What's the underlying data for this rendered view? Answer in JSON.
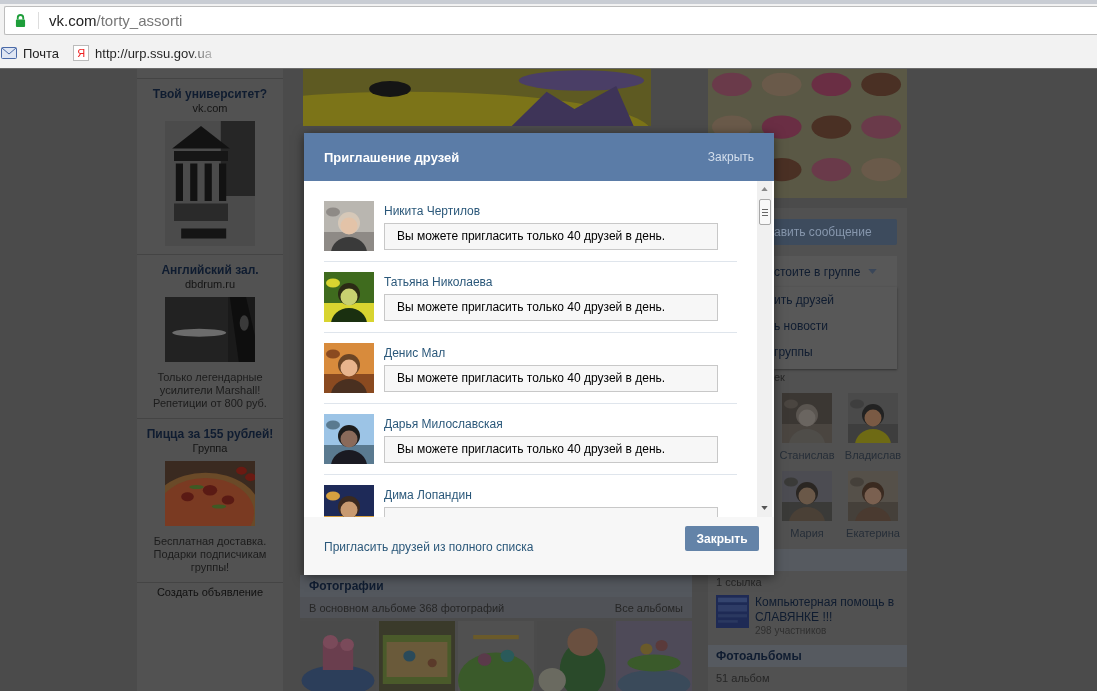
{
  "browser": {
    "address": {
      "host": "vk.com",
      "path": "/torty_assorti"
    },
    "bookmarks": [
      {
        "kind": "mail",
        "label": "Почта"
      },
      {
        "kind": "yandex",
        "icon_text": "Я",
        "label": "http://urp.ssu.gov.ua"
      }
    ]
  },
  "left_ads": [
    {
      "title": "Твой университет?",
      "source": "vk.com"
    },
    {
      "title": "Английский зал.",
      "source": "dbdrum.ru",
      "caption": "Только легендарные усилители Marshall! Репетиции от 800 руб."
    },
    {
      "title": "Пицца за 155 рублей!",
      "source": "Группа",
      "caption": "Бесплатная доставка. Подарки подписчикам группы!"
    }
  ],
  "create_ad": "Создать объявление",
  "photos": {
    "title": "Фотографии",
    "summary": "В основном альбоме 368 фотографий",
    "all_link": "Все альбомы"
  },
  "right": {
    "send_message": "авить сообщение",
    "membership": "стоите в группе",
    "membership_menu": [
      "ить друзей",
      "ь новости",
      "группы"
    ],
    "members_caption": "ек",
    "members": [
      {
        "name": "Станислав"
      },
      {
        "name": "Владислав"
      },
      {
        "name": "Мария"
      },
      {
        "name": "Екатерина"
      }
    ],
    "links_count": "1 ссылка",
    "linked_group": {
      "title": "Компьютерная помощь в СЛАВЯНКЕ !!!",
      "members": "298 участников"
    },
    "albums": {
      "title": "Фотоальбомы",
      "count": "51 альбом"
    }
  },
  "modal": {
    "title": "Приглашение друзей",
    "close_link": "Закрыть",
    "friends": [
      {
        "name": "Никита Чертилов",
        "message": "Вы можете пригласить только 40 друзей в день."
      },
      {
        "name": "Татьяна Николаева",
        "message": "Вы можете пригласить только 40 друзей в день."
      },
      {
        "name": "Денис Мал",
        "message": "Вы можете пригласить только 40 друзей в день."
      },
      {
        "name": "Дарья Милославская",
        "message": "Вы можете пригласить только 40 друзей в день."
      },
      {
        "name": "Дима Лопандин"
      }
    ],
    "invite_all_link": "Пригласить друзей из полного списка",
    "close_button": "Закрыть"
  }
}
